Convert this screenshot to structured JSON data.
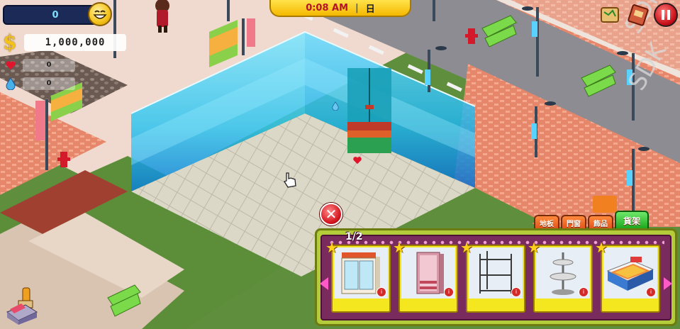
{
  "hud": {
    "coins": "0",
    "money": "1,000,000",
    "hearts": "0",
    "drops": "0",
    "smiley_icon": "smiley-face-icon",
    "money_icon": "dollar-icon",
    "heart_icon": "heart-icon",
    "drop_icon": "water-drop-icon"
  },
  "clock": {
    "time": "0:08 AM",
    "separator": "|",
    "day": "日"
  },
  "top_right": {
    "map_icon": "map-scroll-icon",
    "book_icon": "catalog-book-icon",
    "pause_icon": "pause-icon"
  },
  "editor": {
    "close_icon": "close-icon",
    "page_indicator": "1/2",
    "tabs": [
      {
        "label": "地板",
        "active": false
      },
      {
        "label": "門窗",
        "active": false
      },
      {
        "label": "飾品",
        "active": false
      },
      {
        "label": "貨架",
        "active": true
      }
    ],
    "items": [
      {
        "name": "display-cabinet",
        "icon": "cabinet-icon"
      },
      {
        "name": "pink-rack",
        "icon": "rack-icon"
      },
      {
        "name": "metal-shelf",
        "icon": "shelf-icon"
      },
      {
        "name": "round-stand",
        "icon": "stand-icon"
      },
      {
        "name": "produce-counter",
        "icon": "counter-icon"
      }
    ]
  },
  "colors": {
    "grass": "#5f8f3c",
    "road": "#8c8c92",
    "sidewalk": "#e07a5a",
    "wall_glass": "#3fd2f2",
    "floor": "#d6d3c4",
    "panel_border": "#b4cc3a",
    "panel_bg": "#7a2b5e",
    "active_tab": "#1aa51a"
  }
}
